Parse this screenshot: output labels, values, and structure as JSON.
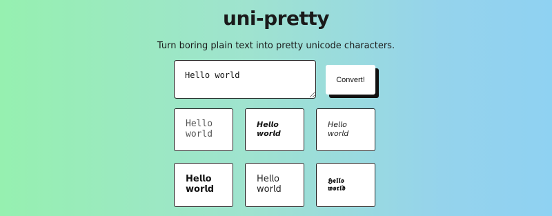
{
  "header": {
    "title": "uni-pretty",
    "subtitle": "Turn boring plain text into pretty unicode characters."
  },
  "input": {
    "value": "Hello world"
  },
  "convert_button": {
    "label": "Convert!"
  },
  "results": [
    {
      "style": "monospace",
      "text": "𝙷𝚎𝚕𝚕𝚘 𝚠𝚘𝚛𝚕𝚍"
    },
    {
      "style": "bold-italic",
      "text": "𝙃𝙚𝙡𝙡𝙤 𝙬𝙤𝙧𝙡𝙙"
    },
    {
      "style": "italic",
      "text": "𝘏𝘦𝘭𝘭𝘰 𝘸𝘰𝘳𝘭𝘥"
    },
    {
      "style": "bold",
      "text": "𝗛𝗲𝗹𝗹𝗼 𝘄𝗼𝗿𝗹𝗱"
    },
    {
      "style": "sans-serif",
      "text": "𝖧𝖾𝗅𝗅𝗈 𝗐𝗈𝗋𝗅𝖽"
    },
    {
      "style": "fraktur-bold",
      "text": "𝕳𝖊𝖑𝖑𝖔 𝖜𝖔𝖗𝖑𝖉"
    }
  ]
}
